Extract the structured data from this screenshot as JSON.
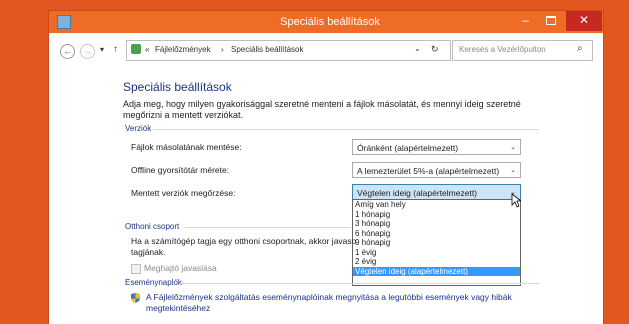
{
  "window": {
    "title": "Speciális beállítások",
    "controls": {
      "minimize": "–",
      "close": "✕"
    }
  },
  "nav": {
    "back": "←",
    "forward": "→",
    "history": "▾",
    "up": "↑"
  },
  "address": {
    "overflow": "«",
    "crumb1": "Fájlelőzmények",
    "separator": "›",
    "crumb2": "Speciális beállítások",
    "dropdown": "⌄",
    "refresh": "↻"
  },
  "search": {
    "placeholder": "Keresés a Vezérlőpulton",
    "icon": "⌕"
  },
  "main": {
    "heading": "Speciális beállítások",
    "description": "Adja meg, hogy milyen gyakorisággal szeretné menteni a fájlok másolatát, és mennyi ideig szeretné megőrizni a mentett verziókat."
  },
  "versions": {
    "group_label": "Verziók",
    "rows": [
      {
        "label": "Fájlok másolatának mentése:",
        "value": "Óránként (alapértelmezett)"
      },
      {
        "label": "Offline gyorsítótár mérete:",
        "value": "A lemezterület 5%-a (alapértelmezett)"
      },
      {
        "label": "Mentett verziók megőrzése:",
        "value": "Végtelen ideig (alapértelmezett)"
      }
    ],
    "chevron": "⌄",
    "retention_options": [
      "Amíg van hely",
      "1 hónapig",
      "3 hónapig",
      "6 hónapig",
      "9 hónapig",
      "1 évig",
      "2 évig",
      "Végtelen ideig (alapértelmezett)"
    ],
    "selected_index": 7
  },
  "homegroup": {
    "group_label": "Otthoni csoport",
    "text_line1": "Ha a számítógép tagja egy otthoni csoportnak, akkor javaso",
    "text_line2": "tagjának.",
    "checkbox_label": "Meghajtó javaslása"
  },
  "eventlogs": {
    "group_label": "Eseménynaplók",
    "link_text": "A Fájlelőzmények szolgáltatás eseménynaplóinak megnyitása a legutóbbi események vagy hibák megtekintéséhez"
  },
  "colors": {
    "accent": "#ee6c26",
    "close": "#c7281f",
    "heading": "#1e3287",
    "selection": "#3399ff"
  }
}
